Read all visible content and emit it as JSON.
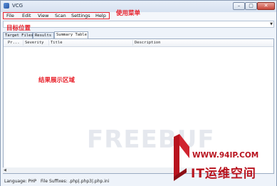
{
  "window": {
    "title": "VCG",
    "controls": {
      "minimize_glyph": "–",
      "maximize_glyph": "▢",
      "close_glyph": "✕"
    }
  },
  "menu": {
    "items": [
      {
        "label": "File"
      },
      {
        "label": "Edit"
      },
      {
        "label": "View"
      },
      {
        "label": "Scan"
      },
      {
        "label": "Settings"
      },
      {
        "label": "Help"
      }
    ]
  },
  "annotations": {
    "menu": "使用菜单",
    "target_location": "目标位置",
    "result_area": "结果展示区域",
    "color": "#e8202a"
  },
  "target_combo": {
    "value": "",
    "arrow_glyph": "▼"
  },
  "tabs": [
    {
      "label": "Target Files",
      "selected": false
    },
    {
      "label": "Results",
      "selected": false
    },
    {
      "label": "Summary Table",
      "selected": true
    }
  ],
  "summary_table": {
    "columns": [
      "Pr...",
      "Severity",
      "Title",
      "Description"
    ],
    "rows": []
  },
  "scrollbar": {
    "left_arrow_glyph": "◀"
  },
  "status": {
    "language": "Language: PHP",
    "file_suffixes": "File Suffixes: .php|.php3|.php.ini"
  },
  "watermarks": {
    "faint_text": "FREEBUF",
    "url": "WWW.94IP.COM",
    "name": "IT运维空间",
    "brand_color": "#b8131e",
    "icons": [
      "logo-graphic"
    ]
  }
}
